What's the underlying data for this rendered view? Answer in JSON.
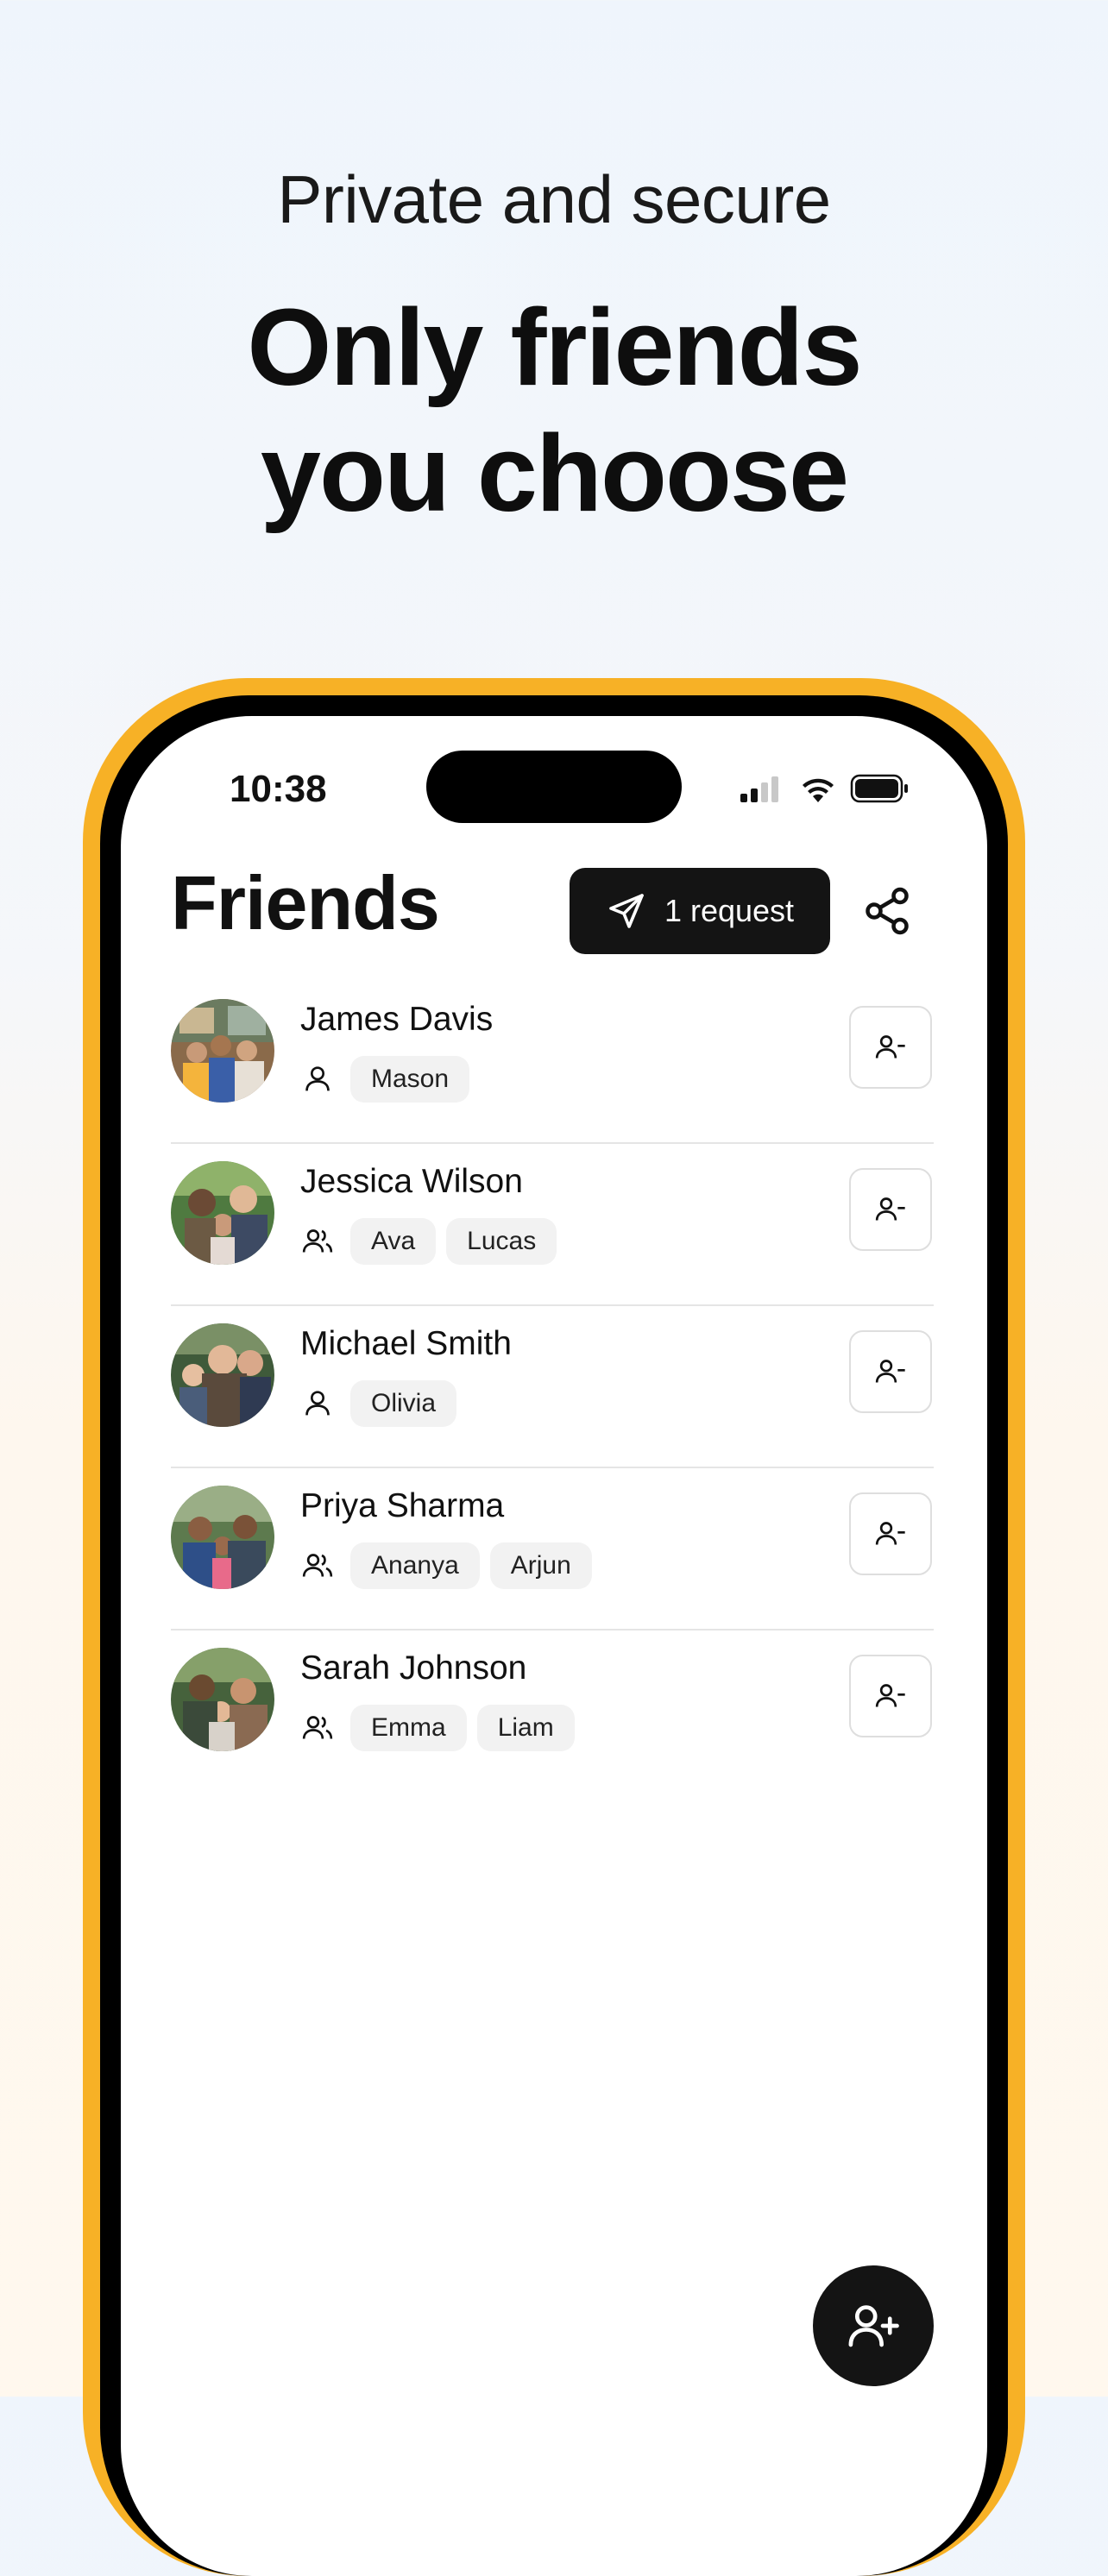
{
  "hero": {
    "eyebrow": "Private and secure",
    "headline_line1": "Only friends",
    "headline_line2": "you choose"
  },
  "status_bar": {
    "time": "10:38"
  },
  "header": {
    "title": "Friends",
    "request_label": "1 request"
  },
  "friends": [
    {
      "name": "James Davis",
      "kids_icon": "person-icon",
      "kids": [
        "Mason"
      ]
    },
    {
      "name": "Jessica Wilson",
      "kids_icon": "people-icon",
      "kids": [
        "Ava",
        "Lucas"
      ]
    },
    {
      "name": "Michael Smith",
      "kids_icon": "person-icon",
      "kids": [
        "Olivia"
      ]
    },
    {
      "name": "Priya Sharma",
      "kids_icon": "people-icon",
      "kids": [
        "Ananya",
        "Arjun"
      ]
    },
    {
      "name": "Sarah Johnson",
      "kids_icon": "people-icon",
      "kids": [
        "Emma",
        "Liam"
      ]
    }
  ],
  "colors": {
    "frame_accent": "#F7B126",
    "button_dark": "#141414",
    "chip_bg": "#F2F2F2"
  }
}
